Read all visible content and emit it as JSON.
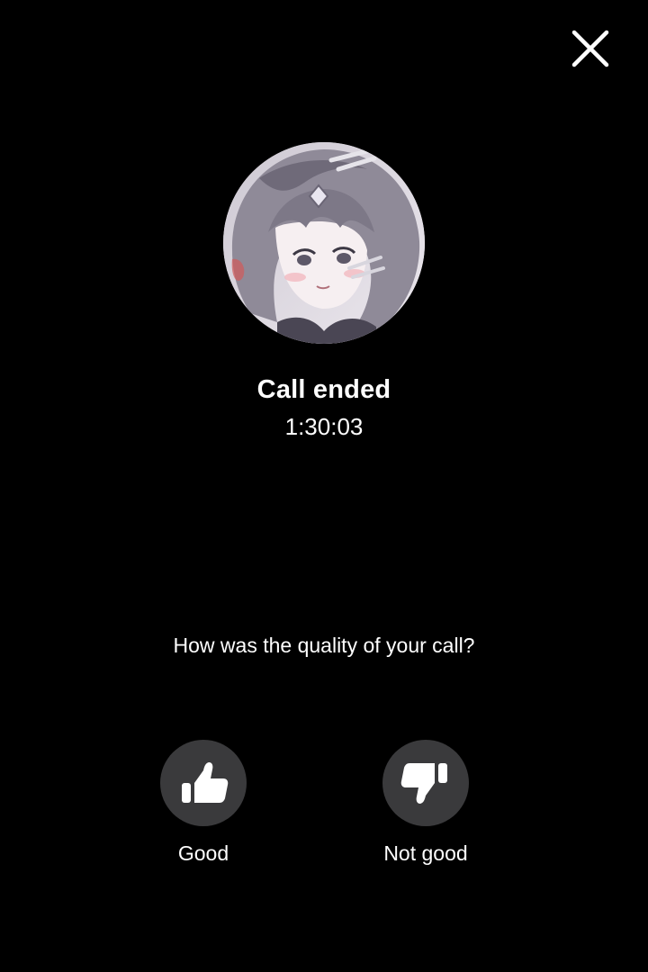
{
  "call": {
    "status": "Call ended",
    "duration": "1:30:03"
  },
  "feedback": {
    "question": "How was the quality of your call?",
    "good_label": "Good",
    "bad_label": "Not good"
  },
  "icons": {
    "close": "close-icon",
    "good": "thumbs-up-icon",
    "bad": "thumbs-down-icon"
  },
  "colors": {
    "background": "#000000",
    "button_circle": "#3a3a3c",
    "text": "#ffffff"
  }
}
